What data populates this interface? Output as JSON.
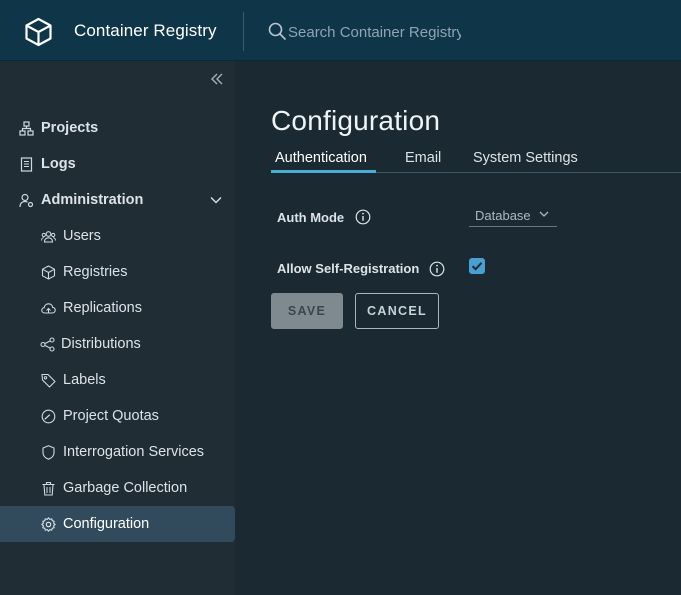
{
  "header": {
    "app_title": "Container Registry",
    "search_placeholder": "Search Container Registry"
  },
  "sidebar": {
    "items": [
      {
        "label": "Projects",
        "icon": "projects-icon"
      },
      {
        "label": "Logs",
        "icon": "logs-icon"
      },
      {
        "label": "Administration",
        "icon": "administration-icon",
        "expanded": true
      },
      {
        "label": "Users",
        "icon": "users-icon"
      },
      {
        "label": "Registries",
        "icon": "registries-icon"
      },
      {
        "label": "Replications",
        "icon": "replications-icon"
      },
      {
        "label": "Distributions",
        "icon": "distributions-icon"
      },
      {
        "label": "Labels",
        "icon": "labels-icon"
      },
      {
        "label": "Project Quotas",
        "icon": "project-quotas-icon"
      },
      {
        "label": "Interrogation Services",
        "icon": "interrogation-services-icon"
      },
      {
        "label": "Garbage Collection",
        "icon": "garbage-collection-icon"
      },
      {
        "label": "Configuration",
        "icon": "configuration-icon",
        "active": true
      }
    ]
  },
  "main": {
    "title": "Configuration",
    "tabs": [
      {
        "label": "Authentication",
        "active": true
      },
      {
        "label": "Email"
      },
      {
        "label": "System Settings"
      }
    ],
    "auth_mode_label": "Auth Mode",
    "auth_mode_value": "Database",
    "self_registration_label": "Allow Self-Registration",
    "self_registration_checked": true,
    "save_label": "SAVE",
    "cancel_label": "CANCEL"
  },
  "colors": {
    "header_bg": "#0f3549",
    "sidebar_bg": "#202d35",
    "main_bg": "#1b2a32",
    "accent": "#4aaed9",
    "active_item_bg": "#324b5c"
  }
}
